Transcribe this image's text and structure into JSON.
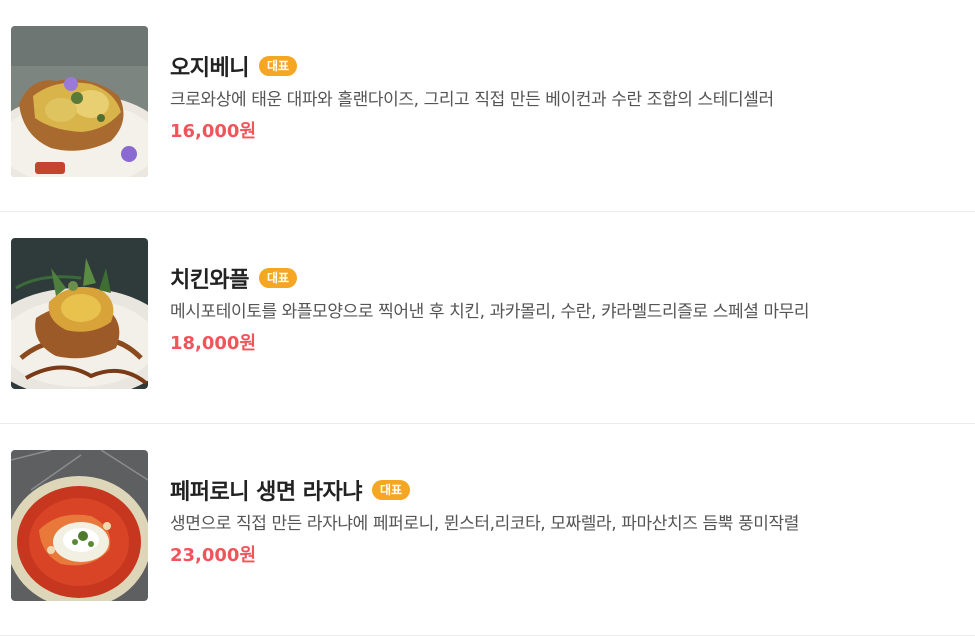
{
  "menu": {
    "items": [
      {
        "name": "오지베니",
        "badge": "대표",
        "description": "크로와상에 태운 대파와 홀랜다이즈, 그리고 직접 만든 베이컨과 수란 조합의 스테디셀러",
        "price": "16,000원"
      },
      {
        "name": "치킨와플",
        "badge": "대표",
        "description": "메시포테이토를 와플모양으로 찍어낸 후 치킨, 과카몰리, 수란, 캬라멜드리즐로 스페셜 마무리",
        "price": "18,000원"
      },
      {
        "name": "페퍼로니 생면 라자냐",
        "badge": "대표",
        "description": "생면으로 직접 만든 라자냐에 페퍼로니, 뮌스터,리코타, 모짜렐라, 파마산치즈 듬뿍 풍미작렬",
        "price": "23,000원"
      }
    ]
  },
  "colors": {
    "badge": "#f5a623",
    "price": "#f2545b",
    "divider": "#ececec"
  }
}
